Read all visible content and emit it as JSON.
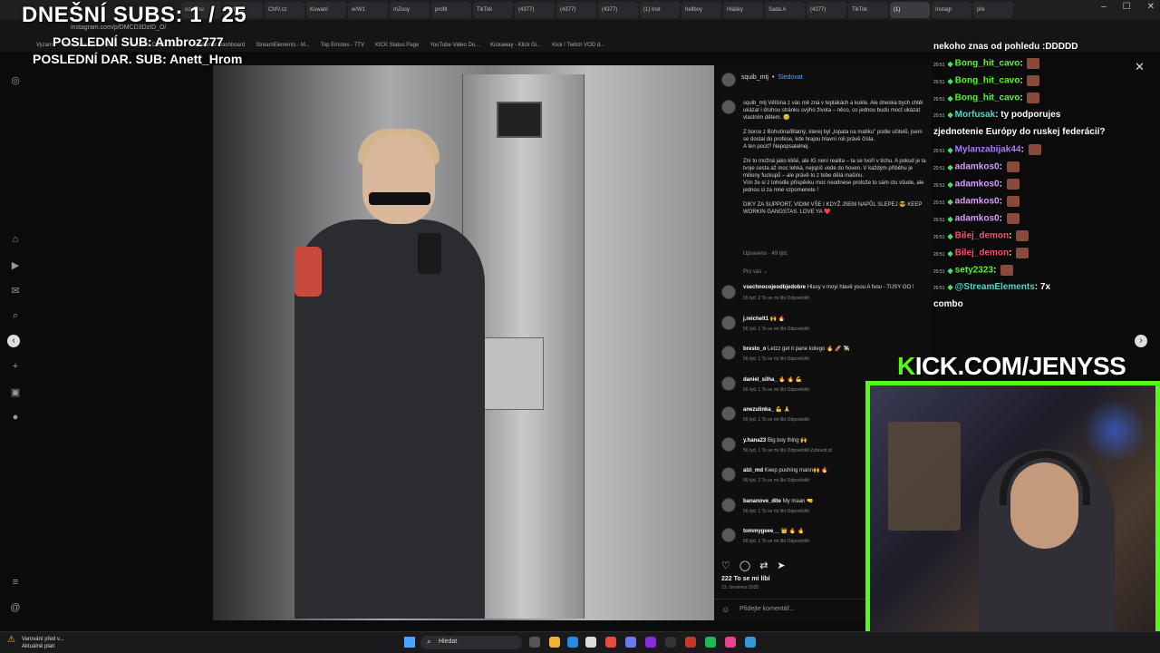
{
  "browser": {
    "tabs": [
      "coiinmu",
      "ChfV.cz",
      "ChfV.cz",
      "Kuwani",
      "w/W1",
      "mZosy",
      "proflt",
      "TikTok",
      "(4377)",
      "(4377)",
      "(4377)",
      "(1) Inst",
      "hellboy",
      "Hlášky",
      "Sada A",
      "(4377)",
      "TikTok",
      "(1)",
      "Instagr",
      "pře"
    ],
    "url": "instagram.com/p/DMCD3DzID_O/",
    "bookmarks": [
      "Vyzam",
      "File Converter - Free...",
      "The best ChatBot an...",
      "Streamer Dashboard",
      "StreamElements - M...",
      "Top Emotes - 7TV",
      "KICK Status Page",
      "YouTube Video Do...",
      "Kickaway - Klick Gi...",
      "Kick / Twitch VOD d..."
    ],
    "controls": {
      "minimize": "–",
      "maximize": "☐",
      "close": "✕"
    }
  },
  "overlay": {
    "subs_goal": "DNEŠNÍ SUBS: 1 / 25",
    "last_sub": "POSLEDNÍ SUB: Ambroz777",
    "last_donation": "POSLEDNÍ DAR. SUB: Anett_Hrom"
  },
  "post": {
    "username": "squib_mtj",
    "dot": "•",
    "follow_label": "Sledovat",
    "caption": "squib_mtj Většina z vás mě zná v teplákách a kukle. Ale dneska bych chtěl ukázat i druhou stránku svýho života – něco, co jednou budu moct ukázat vlastním dětem. 😊\n\nZ borce z Bohutína/Blatný, kterej byl „lopata na matiku\" podle učitelů, jsem se dostal do profese, kde hrajou hlavní roli právě čísla.\nA ten pocit? Nepopsatelnej.\n\nZní to možná jako klišé, ale IG není realita – ta se tvoří v tichu. A pokud je ta tvoje cesta až moc lehká, nejspíš vede do hoven. V každým příběhu je miliony fuckupů – ale právě to z tebe dělá mašinu.\nVím že si z tohodle příspěvku moc neodnese protože to sám ctu všude, ale jednou si za mne vzpomenete !\n\nDIKY ZA SUPPORT, VIDIM VŠE I KDYŽ JSEM NAPŮL SLEPEJ 😎 KEEP WORKIN GANGSTAS. LOVE YA ❤️",
    "caption_meta": "Upraveno · 49 týd.",
    "replies_toggle": "Pro vás ⌄",
    "comments": [
      {
        "user": "vsechnocojeodbjedobre",
        "text": "Hlasy v moyi hlavě ysou A fvou - TUSY GO !",
        "meta": "55 týd.   2 To se mi líbí   Odpovědět"
      },
      {
        "user": "j.reichelt1",
        "text": "🙌 🔥",
        "meta": "56 týd.   1 To se mi líbí   Odpovědět"
      },
      {
        "user": "bresto_o",
        "text": "Letzz get it pane kolego 🔥 🚀 💸",
        "meta": "56 týd.   1 To se mi líbí   Odpovědět"
      },
      {
        "user": "daniel_silha_",
        "text": "🔥 🔥 💪",
        "meta": "56 týd.   1 To se mi líbí   Odpovědět"
      },
      {
        "user": "anezulinka_",
        "text": "💪 🙏",
        "meta": "56 týd.   1 To se mi líbí   Odpovědět"
      },
      {
        "user": "y.hana23",
        "text": "Big boy thing 🙌",
        "meta": "56 týd.   1 To se mi líbí   Odpovědět   Zobrazit př"
      },
      {
        "user": "alzi_md",
        "text": "Keep pushing mann🙌 🔥",
        "meta": "56 týd.   2 To se mi líbí   Odpovědět"
      },
      {
        "user": "bananove_dite",
        "text": "My maan 🤜",
        "meta": "56 týd.   1 To se mi líbí   Odpovědět"
      },
      {
        "user": "tommygeee__",
        "text": "👑 🔥 🔥",
        "meta": "56 týd.   1 To se mi líbí   Odpovědět"
      }
    ],
    "likes": "222 To se mi líbí",
    "date": "13. července 2025",
    "add_comment_placeholder": "Přidejte komentář..."
  },
  "chat": {
    "header": "nekoho znas od pohledu :DDDDD",
    "lines": [
      {
        "ts": "20:51",
        "user": "Bong_hit_cavo",
        "sep": ":",
        "msg": "",
        "color": "#53fc18"
      },
      {
        "ts": "20:51",
        "user": "Bong_hit_cavo",
        "sep": ":",
        "msg": "",
        "color": "#53fc18"
      },
      {
        "ts": "20:51",
        "user": "Bong_hit_cavo",
        "sep": ":",
        "msg": "",
        "color": "#53fc18"
      },
      {
        "ts": "20:51",
        "user": "Morfusak",
        "sep": ":",
        "msg": "ty podporujes",
        "color": "#4fd8c8"
      },
      {
        "ts": "",
        "user": "",
        "sep": "",
        "msg": "zjednotenie Európy do ruskej federácií?",
        "color": "#ffffff"
      },
      {
        "ts": "20:51",
        "user": "Mylanzabijak44",
        "sep": ":",
        "msg": "",
        "color": "#b07cff"
      },
      {
        "ts": "20:51",
        "user": "adamkos0",
        "sep": ":",
        "msg": "",
        "color": "#d8a0ff"
      },
      {
        "ts": "20:51",
        "user": "adamkos0",
        "sep": ":",
        "msg": "",
        "color": "#d8a0ff"
      },
      {
        "ts": "20:51",
        "user": "adamkos0",
        "sep": ":",
        "msg": "",
        "color": "#d8a0ff"
      },
      {
        "ts": "20:51",
        "user": "adamkos0",
        "sep": ":",
        "msg": "",
        "color": "#d8a0ff"
      },
      {
        "ts": "20:51",
        "user": "Bilej_demon",
        "sep": ":",
        "msg": "",
        "color": "#ff4d6d"
      },
      {
        "ts": "20:51",
        "user": "Bilej_demon",
        "sep": ":",
        "msg": "",
        "color": "#ff4d6d"
      },
      {
        "ts": "20:51",
        "user": "sety2323",
        "sep": ":",
        "msg": "",
        "color": "#53fc18"
      },
      {
        "ts": "20:51",
        "user": "@StreamElements",
        "sep": ":",
        "msg": "7x",
        "color": "#4fd8c8"
      },
      {
        "ts": "",
        "user": "",
        "sep": "",
        "msg": "combo",
        "color": "#ffffff"
      }
    ]
  },
  "stream": {
    "kick_url_k": "K",
    "kick_url_rest": "ICK.COM/JENYSS",
    "accent": "#53fc18"
  },
  "taskbar": {
    "warning_line1": "Varování před v...",
    "warning_line2": "Aktuálně platí",
    "search_label": "Hledat"
  },
  "photo_scene": {
    "elevator_display": "⌂ ⌂"
  }
}
